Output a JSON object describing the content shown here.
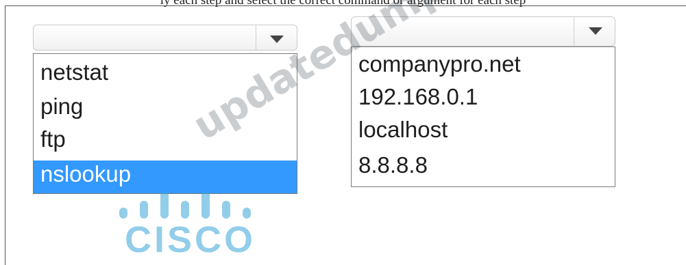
{
  "header": {
    "text": "ly each step and select the correct command or argument for each step"
  },
  "command_dropdown": {
    "selected_value": "",
    "options": [
      "netstat",
      "ping",
      "ftp",
      "nslookup"
    ],
    "highlighted_option": "nslookup"
  },
  "target_dropdown": {
    "selected_value": "",
    "options": [
      "companypro.net",
      "192.168.0.1",
      "localhost",
      "8.8.8.8"
    ]
  },
  "icons": {
    "dropdown_caret": "chevron-down-icon"
  },
  "watermark": {
    "text": "updatedumps.com"
  },
  "logo": {
    "text": "CISCO"
  },
  "colors": {
    "highlight": "#3399ff",
    "highlight_text": "#ffffff",
    "logo": "#3aa6d8"
  }
}
